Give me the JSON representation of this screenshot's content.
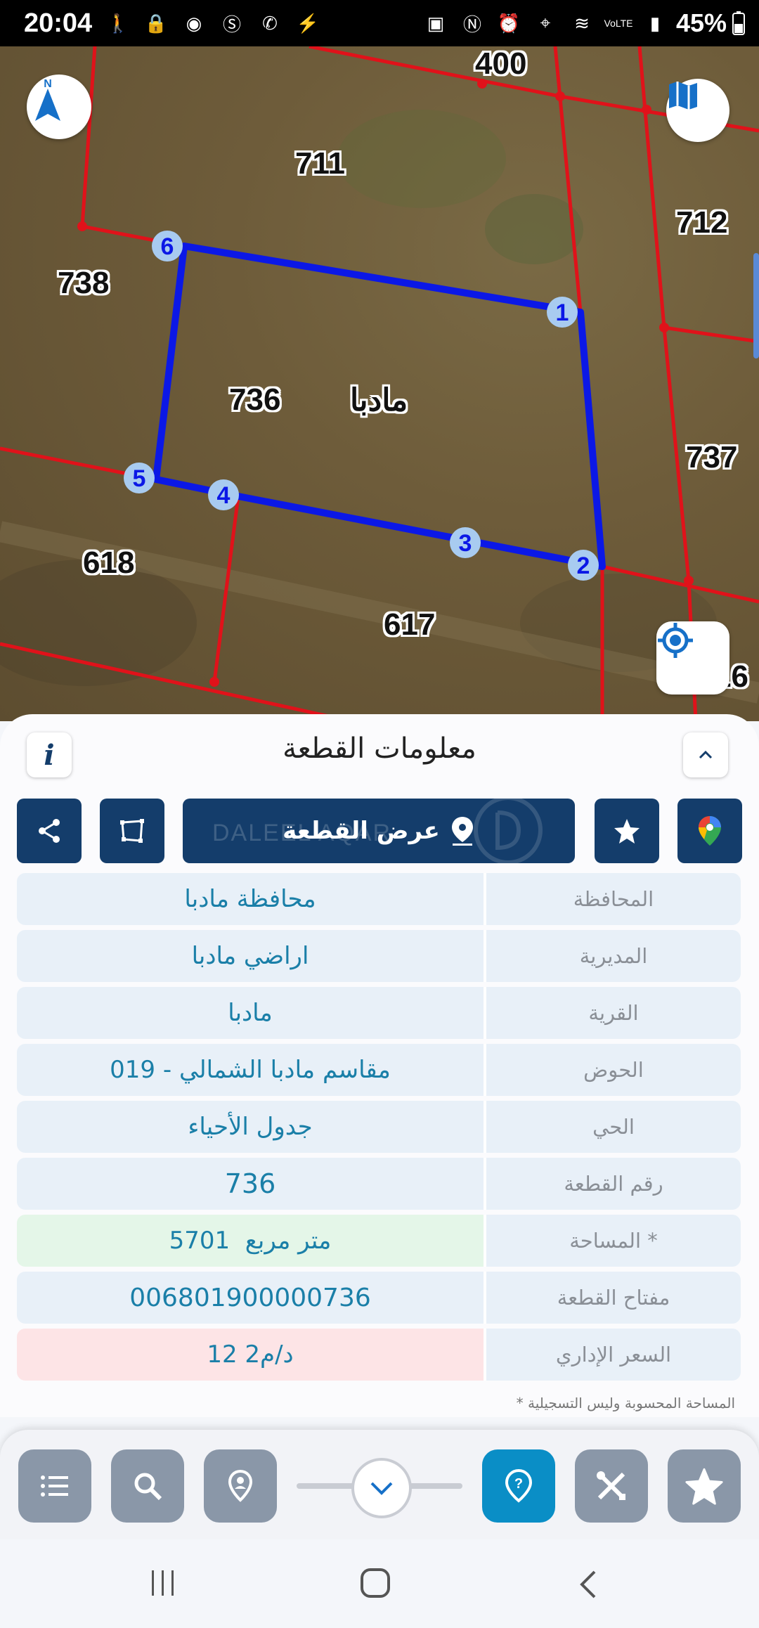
{
  "status_bar": {
    "time": "20:04",
    "battery": "45%",
    "left_icons": [
      "walk-icon",
      "lock-icon",
      "app-icon",
      "shazam-icon",
      "viber-icon",
      "bolt-icon"
    ],
    "right_icons": [
      "android-icon",
      "nfc-icon",
      "alarm-icon",
      "location-icon",
      "wifi-icon",
      "volte-icon",
      "signal-icon"
    ]
  },
  "map": {
    "compass_label": "N",
    "lot_labels": [
      "400",
      "711",
      "712",
      "738",
      "736",
      "مادبا",
      "737",
      "618",
      "617",
      "16"
    ],
    "vertex_labels": [
      "1",
      "2",
      "3",
      "4",
      "5",
      "6"
    ],
    "colors": {
      "selected_outline": "#0b18e6",
      "boundary": "#e0121a",
      "vertex_fill": "#a8cbf0"
    }
  },
  "panel": {
    "title": "معلومات القطعة",
    "show_parcel_label": "عرض القطعة",
    "watermark": "DALEEL AQAR",
    "rows": [
      {
        "key": "المحافظة",
        "value": "محافظة مادبا",
        "tone": "normal"
      },
      {
        "key": "المديرية",
        "value": "اراضي مادبا",
        "tone": "normal"
      },
      {
        "key": "القرية",
        "value": "مادبا",
        "tone": "normal"
      },
      {
        "key": "الحوض",
        "value": "مقاسم مادبا الشمالي - 019",
        "tone": "normal"
      },
      {
        "key": "الحي",
        "value": "جدول الأحياء",
        "tone": "normal"
      },
      {
        "key": "رقم القطعة",
        "value": "736",
        "tone": "normal"
      },
      {
        "key": "المساحة *",
        "value": "5701  متر مربع",
        "tone": "green"
      },
      {
        "key": "مفتاح القطعة",
        "value": "006801900000736",
        "tone": "normal"
      },
      {
        "key": "السعر الإداري",
        "value": "12 د/م2",
        "tone": "red"
      }
    ],
    "footnote": "* المساحة المحسوبة وليس التسجيلية",
    "action_colors": {
      "dark": "#143d6b",
      "accent": "#0a8ec6"
    }
  }
}
